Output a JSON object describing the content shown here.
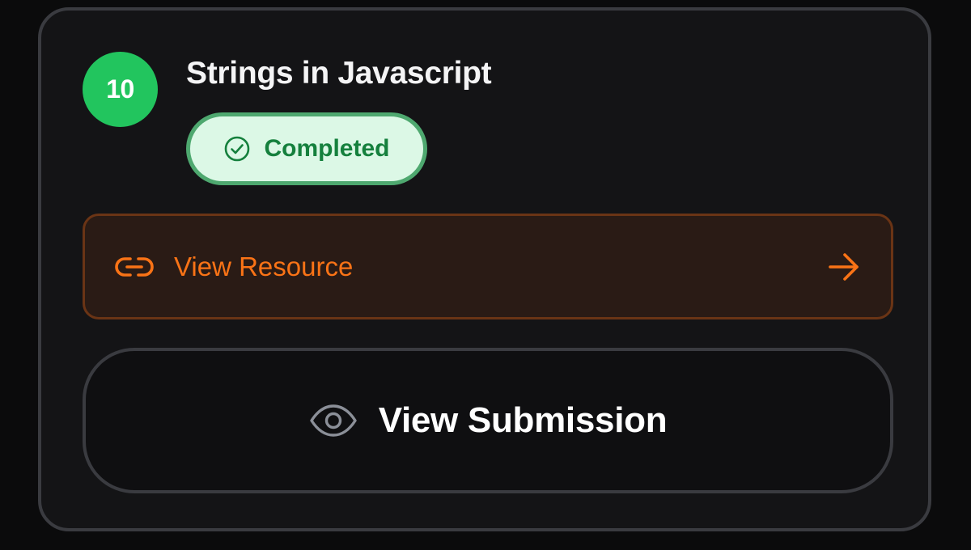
{
  "lesson": {
    "number": "10",
    "title": "Strings in Javascript",
    "status": "Completed",
    "status_icon": "check-circle-icon"
  },
  "resource": {
    "label": "View Resource",
    "leading_icon": "link-icon",
    "trailing_icon": "arrow-right-icon"
  },
  "submission": {
    "label": "View Submission",
    "icon": "eye-icon"
  },
  "colors": {
    "badge": "#22c55e",
    "status_text": "#15803d",
    "status_bg": "#dcf8e6",
    "status_border": "#4ea86f",
    "accent_orange": "#f97316",
    "resource_bg": "#2a1b15",
    "card_bg": "#141416",
    "card_border": "#3a3b40"
  }
}
